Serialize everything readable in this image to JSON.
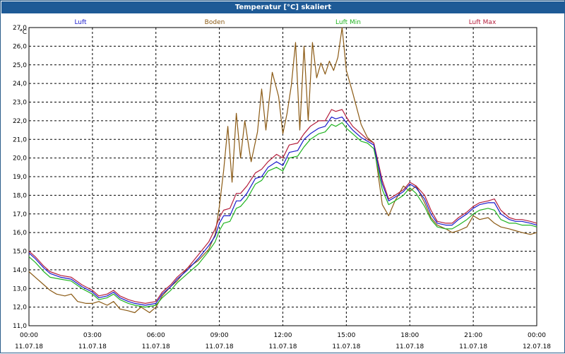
{
  "window": {
    "title": "Temperatur [°C] skaliert"
  },
  "chart_data": {
    "type": "line",
    "title": "Temperatur [°C] skaliert",
    "ylabel": "°C",
    "xlabel": "",
    "ylim": [
      11.0,
      27.0
    ],
    "y_ticks": [
      "11,0",
      "12,0",
      "13,0",
      "14,0",
      "15,0",
      "16,0",
      "17,0",
      "18,0",
      "19,0",
      "20,0",
      "21,0",
      "22,0",
      "23,0",
      "24,0",
      "25,0",
      "26,0",
      "27,0"
    ],
    "x_ticks": [
      {
        "time": "00:00",
        "date": "11.07.18",
        "hour": 0
      },
      {
        "time": "03:00",
        "date": "11.07.18",
        "hour": 3
      },
      {
        "time": "06:00",
        "date": "11.07.18",
        "hour": 6
      },
      {
        "time": "09:00",
        "date": "11.07.18",
        "hour": 9
      },
      {
        "time": "12:00",
        "date": "11.07.18",
        "hour": 12
      },
      {
        "time": "15:00",
        "date": "11.07.18",
        "hour": 15
      },
      {
        "time": "18:00",
        "date": "11.07.18",
        "hour": 18
      },
      {
        "time": "21:00",
        "date": "11.07.18",
        "hour": 21
      },
      {
        "time": "00:00",
        "date": "12.07.18",
        "hour": 24
      }
    ],
    "grid": true,
    "legend_position": "top",
    "series": [
      {
        "name": "Luft",
        "color": "#1a1acc",
        "x": [
          0,
          0.3,
          0.7,
          1.0,
          1.5,
          2.0,
          2.5,
          3.0,
          3.3,
          3.7,
          4.0,
          4.3,
          4.7,
          5.0,
          5.5,
          6.0,
          6.3,
          6.7,
          7.0,
          7.5,
          8.0,
          8.5,
          8.8,
          9.0,
          9.2,
          9.5,
          9.8,
          10.0,
          10.3,
          10.7,
          11.0,
          11.3,
          11.7,
          12.0,
          12.3,
          12.7,
          13.0,
          13.3,
          13.7,
          14.0,
          14.3,
          14.5,
          14.8,
          15.0,
          15.3,
          15.7,
          16.0,
          16.3,
          16.7,
          17.0,
          17.3,
          17.7,
          18.0,
          18.3,
          18.7,
          19.0,
          19.3,
          19.7,
          20.0,
          20.3,
          20.7,
          21.0,
          21.3,
          21.7,
          22.0,
          22.3,
          22.7,
          23.0,
          23.3,
          23.7,
          24.0
        ],
        "values": [
          14.9,
          14.6,
          14.1,
          13.8,
          13.6,
          13.5,
          13.1,
          12.8,
          12.5,
          12.6,
          12.8,
          12.5,
          12.3,
          12.2,
          12.1,
          12.2,
          12.7,
          13.1,
          13.5,
          14.0,
          14.6,
          15.3,
          15.8,
          16.5,
          16.9,
          16.9,
          17.7,
          17.7,
          18.1,
          18.9,
          19.0,
          19.5,
          19.8,
          19.6,
          20.3,
          20.4,
          21.0,
          21.3,
          21.6,
          21.7,
          22.2,
          22.1,
          22.2,
          21.9,
          21.5,
          21.1,
          20.9,
          20.7,
          18.6,
          17.7,
          17.9,
          18.2,
          18.6,
          18.4,
          17.8,
          17.0,
          16.5,
          16.4,
          16.4,
          16.7,
          17.0,
          17.3,
          17.5,
          17.6,
          17.6,
          17.0,
          16.7,
          16.6,
          16.6,
          16.5,
          16.4
        ]
      },
      {
        "name": "Boden",
        "color": "#8b5a14",
        "x": [
          0,
          0.3,
          0.7,
          1.0,
          1.3,
          1.7,
          2.0,
          2.3,
          2.7,
          3.0,
          3.3,
          3.7,
          4.0,
          4.3,
          4.7,
          5.0,
          5.3,
          5.7,
          6.0,
          6.3,
          6.7,
          7.0,
          7.5,
          8.0,
          8.5,
          8.8,
          9.0,
          9.2,
          9.4,
          9.6,
          9.8,
          10.0,
          10.2,
          10.5,
          10.8,
          11.0,
          11.2,
          11.5,
          11.8,
          12.0,
          12.2,
          12.4,
          12.6,
          12.8,
          13.0,
          13.2,
          13.4,
          13.6,
          13.8,
          14.0,
          14.2,
          14.4,
          14.6,
          14.8,
          15.0,
          15.3,
          15.7,
          16.0,
          16.3,
          16.7,
          17.0,
          17.3,
          17.7,
          18.0,
          18.3,
          18.7,
          19.0,
          19.3,
          19.7,
          20.0,
          20.3,
          20.7,
          21.0,
          21.3,
          21.7,
          22.0,
          22.3,
          22.7,
          23.0,
          23.3,
          23.7,
          24.0
        ],
        "values": [
          13.9,
          13.6,
          13.2,
          12.9,
          12.7,
          12.6,
          12.7,
          12.3,
          12.2,
          12.2,
          12.3,
          12.1,
          12.3,
          11.9,
          11.8,
          11.7,
          12.0,
          11.7,
          12.0,
          12.6,
          13.1,
          13.4,
          14.1,
          14.5,
          15.1,
          15.9,
          17.4,
          19.3,
          21.7,
          18.7,
          22.4,
          20.0,
          22.0,
          19.8,
          21.4,
          23.7,
          21.5,
          24.6,
          23.3,
          21.3,
          22.4,
          23.9,
          26.2,
          21.5,
          26.0,
          22.0,
          26.2,
          24.3,
          25.1,
          24.5,
          25.2,
          24.7,
          25.4,
          27.0,
          24.7,
          23.5,
          21.8,
          21.1,
          20.8,
          17.5,
          16.9,
          17.7,
          18.5,
          18.2,
          18.5,
          17.6,
          16.8,
          16.4,
          16.2,
          16.0,
          16.1,
          16.3,
          16.9,
          16.7,
          16.8,
          16.5,
          16.3,
          16.2,
          16.1,
          16.0,
          15.9,
          16.0
        ]
      },
      {
        "name": "Luft Min",
        "color": "#22b422",
        "x": [
          0,
          0.3,
          0.7,
          1.0,
          1.5,
          2.0,
          2.5,
          3.0,
          3.3,
          3.7,
          4.0,
          4.3,
          4.7,
          5.0,
          5.5,
          6.0,
          6.3,
          6.7,
          7.0,
          7.5,
          8.0,
          8.5,
          8.8,
          9.0,
          9.2,
          9.5,
          9.8,
          10.0,
          10.3,
          10.7,
          11.0,
          11.3,
          11.7,
          12.0,
          12.3,
          12.7,
          13.0,
          13.3,
          13.7,
          14.0,
          14.3,
          14.5,
          14.8,
          15.0,
          15.3,
          15.7,
          16.0,
          16.3,
          16.7,
          17.0,
          17.3,
          17.7,
          18.0,
          18.3,
          18.7,
          19.0,
          19.3,
          19.7,
          20.0,
          20.3,
          20.7,
          21.0,
          21.3,
          21.7,
          22.0,
          22.3,
          22.7,
          23.0,
          23.3,
          23.7,
          24.0
        ],
        "values": [
          14.7,
          14.4,
          13.9,
          13.6,
          13.5,
          13.4,
          13.0,
          12.7,
          12.4,
          12.5,
          12.7,
          12.4,
          12.2,
          12.1,
          12.0,
          12.1,
          12.5,
          12.9,
          13.3,
          13.8,
          14.3,
          15.0,
          15.5,
          16.1,
          16.5,
          16.6,
          17.3,
          17.4,
          17.8,
          18.6,
          18.8,
          19.3,
          19.5,
          19.3,
          20.0,
          20.1,
          20.6,
          21.0,
          21.3,
          21.4,
          21.8,
          21.7,
          21.9,
          21.6,
          21.3,
          20.9,
          20.8,
          20.5,
          18.3,
          17.5,
          17.7,
          18.0,
          18.4,
          18.1,
          17.4,
          16.7,
          16.3,
          16.2,
          16.2,
          16.4,
          16.7,
          17.0,
          17.2,
          17.3,
          17.2,
          16.7,
          16.5,
          16.5,
          16.4,
          16.4,
          16.3
        ]
      },
      {
        "name": "Luft Max",
        "color": "#b41e3c",
        "x": [
          0,
          0.3,
          0.7,
          1.0,
          1.5,
          2.0,
          2.5,
          3.0,
          3.3,
          3.7,
          4.0,
          4.3,
          4.7,
          5.0,
          5.5,
          6.0,
          6.3,
          6.7,
          7.0,
          7.5,
          8.0,
          8.5,
          8.8,
          9.0,
          9.2,
          9.5,
          9.8,
          10.0,
          10.3,
          10.7,
          11.0,
          11.3,
          11.7,
          12.0,
          12.3,
          12.7,
          13.0,
          13.3,
          13.7,
          14.0,
          14.3,
          14.5,
          14.8,
          15.0,
          15.3,
          15.7,
          16.0,
          16.3,
          16.7,
          17.0,
          17.3,
          17.7,
          18.0,
          18.3,
          18.7,
          19.0,
          19.3,
          19.7,
          20.0,
          20.3,
          20.7,
          21.0,
          21.3,
          21.7,
          22.0,
          22.3,
          22.7,
          23.0,
          23.3,
          23.7,
          24.0
        ],
        "values": [
          15.0,
          14.7,
          14.2,
          13.9,
          13.7,
          13.6,
          13.2,
          12.9,
          12.6,
          12.7,
          12.9,
          12.6,
          12.4,
          12.3,
          12.2,
          12.3,
          12.8,
          13.2,
          13.6,
          14.1,
          14.8,
          15.5,
          16.2,
          16.8,
          17.2,
          17.3,
          18.1,
          18.1,
          18.5,
          19.2,
          19.4,
          19.8,
          20.2,
          20.0,
          20.7,
          20.8,
          21.3,
          21.7,
          22.0,
          22.0,
          22.6,
          22.5,
          22.6,
          22.2,
          21.7,
          21.3,
          21.0,
          20.8,
          18.8,
          17.8,
          18.0,
          18.3,
          18.7,
          18.5,
          18.0,
          17.2,
          16.6,
          16.5,
          16.5,
          16.8,
          17.1,
          17.4,
          17.6,
          17.7,
          17.8,
          17.2,
          16.8,
          16.7,
          16.7,
          16.6,
          16.5
        ]
      }
    ]
  }
}
